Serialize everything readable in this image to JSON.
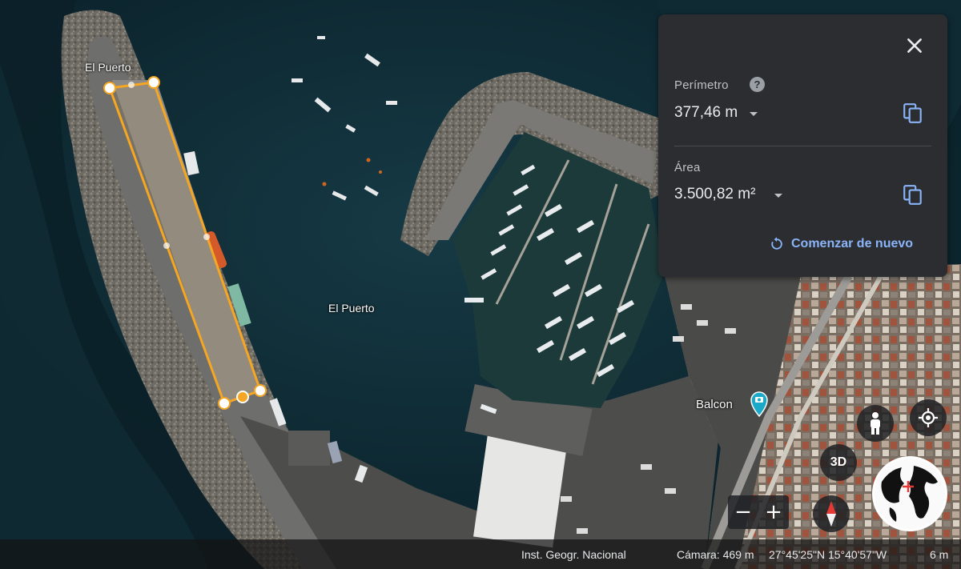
{
  "map": {
    "labels": {
      "pier_label": "El Puerto",
      "harbor_label": "El Puerto",
      "poi_label": "Balcon"
    }
  },
  "measure_panel": {
    "perimeter_label": "Perímetro",
    "perimeter_value": "377,46 m",
    "area_label": "Área",
    "area_value": "3.500,82 m²",
    "restart_label": "Comenzar de nuevo",
    "help_glyph": "?"
  },
  "controls": {
    "three_d_label": "3D",
    "zoom_out": "−",
    "zoom_in": "+"
  },
  "status_bar": {
    "attribution": "Inst. Geogr. Nacional",
    "camera": "Cámara: 469 m",
    "coordinates": "27°45'25\"N 15°40'57\"W",
    "scale": "6 m"
  },
  "colors": {
    "measure_line": "#f5a623",
    "accent_link": "#8ab4f8",
    "panel_bg": "#2b2d30",
    "poi_pin": "#1aa9c9"
  },
  "icons": [
    "close-icon",
    "help-icon",
    "copy-icon",
    "restart-icon",
    "pegman-icon",
    "locate-icon",
    "compass-icon",
    "globe-icon",
    "camera-pin-icon",
    "dropdown-icon"
  ]
}
